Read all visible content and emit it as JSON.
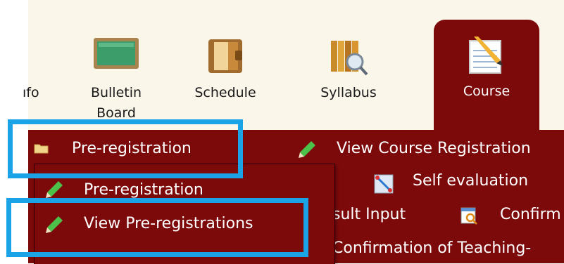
{
  "tabs": {
    "info_label": "ıfo",
    "bulletin_label": "Bulletin\nBoard",
    "schedule_label": "Schedule",
    "syllabus_label": "Syllabus",
    "course_label": "Course"
  },
  "menu": {
    "pre_registration_label": "Pre-registration",
    "view_course_registration_label": "View Course Registration",
    "self_evaluation_label": "Self evaluation",
    "result_input_label": "sult Input",
    "confirm_label": "Confirm",
    "confirmation_teaching_label": "Confirmation of Teaching-"
  },
  "dropdown": {
    "items": [
      {
        "label": "Pre-registration"
      },
      {
        "label": "View Pre-registrations"
      }
    ]
  },
  "colors": {
    "menu_bg": "#7d0a0a",
    "tabbar_bg": "#fbf6ea",
    "highlight": "#1aa3e6"
  }
}
